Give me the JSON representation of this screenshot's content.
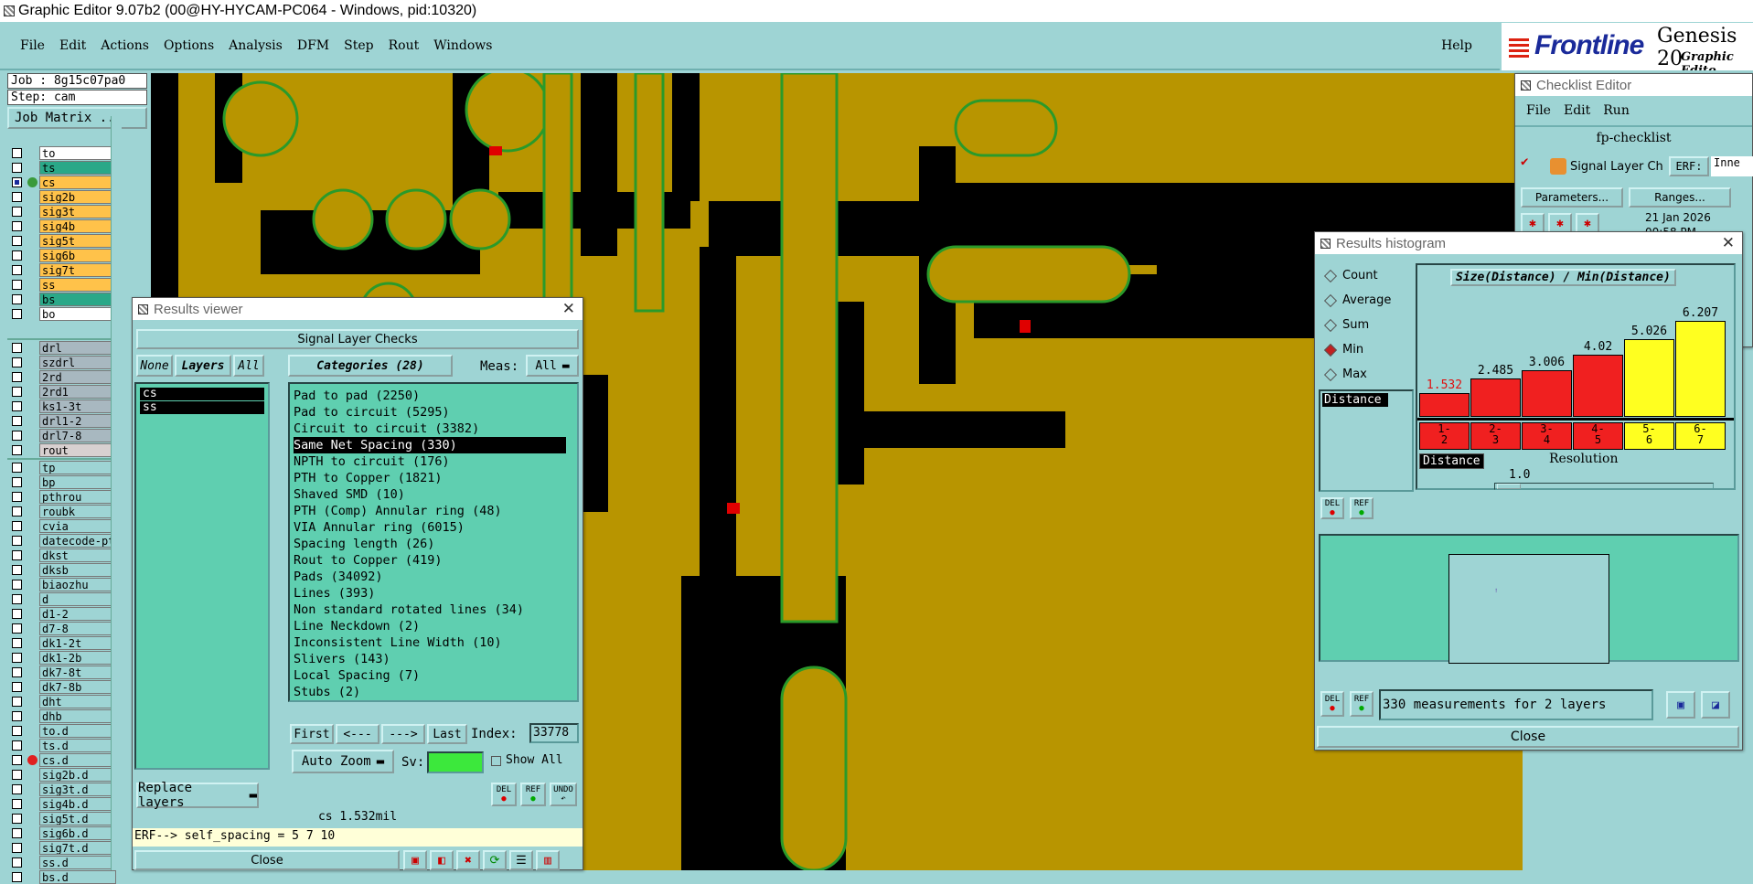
{
  "app": {
    "title": "Graphic Editor 9.07b2 (00@HY-HYCAM-PC064 - Windows, pid:10320)",
    "menu": [
      "File",
      "Edit",
      "Actions",
      "Options",
      "Analysis",
      "DFM",
      "Step",
      "Rout",
      "Windows"
    ],
    "help": "Help",
    "logo_text": "Frontline",
    "logo_product": "Genesis 20",
    "logo_sub": "Graphic Edito"
  },
  "left": {
    "job": "Job : 8g15c07pa0",
    "step": "Step: cam",
    "job_matrix": "Job Matrix ...",
    "layers_top": [
      {
        "name": "to",
        "color": "#ffffff"
      },
      {
        "name": "ts",
        "color": "#2aa888"
      },
      {
        "name": "cs",
        "color": "#ffc24a",
        "active": true
      },
      {
        "name": "sig2b",
        "color": "#ffc24a"
      },
      {
        "name": "sig3t",
        "color": "#ffc24a"
      },
      {
        "name": "sig4b",
        "color": "#ffc24a"
      },
      {
        "name": "sig5t",
        "color": "#ffc24a"
      },
      {
        "name": "sig6b",
        "color": "#ffc24a"
      },
      {
        "name": "sig7t",
        "color": "#ffc24a"
      },
      {
        "name": "ss",
        "color": "#ffc24a"
      },
      {
        "name": "bs",
        "color": "#2aa888"
      },
      {
        "name": "bo",
        "color": "#ffffff"
      }
    ],
    "layers_drill": [
      {
        "name": "drl",
        "color": "#a8b8c0"
      },
      {
        "name": "szdrl",
        "color": "#a8b8c0"
      },
      {
        "name": "2rd",
        "color": "#a8b8c0"
      },
      {
        "name": "2rd1",
        "color": "#a8b8c0"
      },
      {
        "name": "ks1-3t",
        "color": "#a8b8c0"
      },
      {
        "name": "drl1-2",
        "color": "#a8b8c0"
      },
      {
        "name": "drl7-8",
        "color": "#a8b8c0"
      },
      {
        "name": "rout",
        "color": "#d8d0d0"
      }
    ],
    "layers_misc": [
      "tp",
      "bp",
      "pthrou",
      "roubk",
      "cvia",
      "datecode-pte",
      "dkst",
      "dksb",
      "biaozhu",
      "d",
      "d1-2",
      "d7-8",
      "dk1-2t",
      "dk1-2b",
      "dk7-8t",
      "dk7-8b",
      "dht",
      "dhb",
      "to.d",
      "ts.d",
      "cs.d",
      "sig2b.d",
      "sig3t.d",
      "sig4b.d",
      "sig5t.d",
      "sig6b.d",
      "sig7t.d",
      "ss.d",
      "bs.d"
    ]
  },
  "results_viewer": {
    "title": "Results viewer",
    "header": "Signal Layer Checks",
    "none_btn": "None",
    "layers_btn": "Layers",
    "all_btn": "All",
    "categories_btn": "Categories (28)",
    "meas_label": "Meas:",
    "meas_value": "All",
    "layers": [
      "cs",
      "ss"
    ],
    "categories": [
      "Pad to pad (2250)",
      "Pad to circuit (5295)",
      "Circuit to circuit (3382)",
      "Same Net Spacing (330)",
      "NPTH to circuit (176)",
      "PTH to Copper (1821)",
      "Shaved SMD (10)",
      "PTH (Comp) Annular ring (48)",
      "VIA Annular ring (6015)",
      "Spacing length (26)",
      "Rout to Copper (419)",
      "Pads (34092)",
      "Lines (393)",
      "Non standard rotated lines (34)",
      "Line Neckdown (2)",
      "Inconsistent Line Width (10)",
      "Slivers (143)",
      "Local Spacing (7)",
      "Stubs (2)"
    ],
    "selected_category": 3,
    "first": "First",
    "prev": "<---",
    "next": "--->",
    "last": "Last",
    "index_label": "Index:",
    "index_value": "33778",
    "auto_zoom": "Auto Zoom",
    "sv_label": "Sv:",
    "show_all": "Show All",
    "replace_layers": "Replace layers",
    "del": "DEL",
    "ref": "REF",
    "undo": "UNDO",
    "status": "cs 1.532mil",
    "erf_line": "ERF--> self_spacing = 5 7 10",
    "close": "Close"
  },
  "checklist": {
    "title": "Checklist Editor",
    "menu": [
      "File",
      "Edit",
      "Run"
    ],
    "name": "fp-checklist",
    "row_label": "Signal Layer Ch",
    "erf": "ERF:",
    "erf_value": "Inne",
    "parameters": "Parameters...",
    "ranges": "Ranges...",
    "date": "21 Jan 2026",
    "time": "00:58 PM"
  },
  "histogram": {
    "title": "Results histogram",
    "options": [
      "Count",
      "Average",
      "Sum",
      "Min",
      "Max"
    ],
    "selected_option": "Min",
    "list_item": "Distance",
    "heading": "Size(Distance) / Min(Distance)",
    "resolution_label": "Resolution",
    "resolution_value": "1.0",
    "res_field": "Distance",
    "status": "330 measurements for 2 layers",
    "close": "Close",
    "del": "DEL",
    "ref": "REF",
    "bars": [
      {
        "label": "1-\n2",
        "value": 1.532,
        "text": "1.532",
        "color": "#f02020"
      },
      {
        "label": "2-\n3",
        "value": 2.485,
        "text": "2.485",
        "color": "#f02020"
      },
      {
        "label": "3-\n4",
        "value": 3.006,
        "text": "3.006",
        "color": "#f02020"
      },
      {
        "label": "4-\n5",
        "value": 4.02,
        "text": "4.02",
        "color": "#f02020"
      },
      {
        "label": "5-\n6",
        "value": 5.026,
        "text": "5.026",
        "color": "#ffff20"
      },
      {
        "label": "6-\n7",
        "value": 6.207,
        "text": "6.207",
        "color": "#ffff20"
      }
    ]
  }
}
